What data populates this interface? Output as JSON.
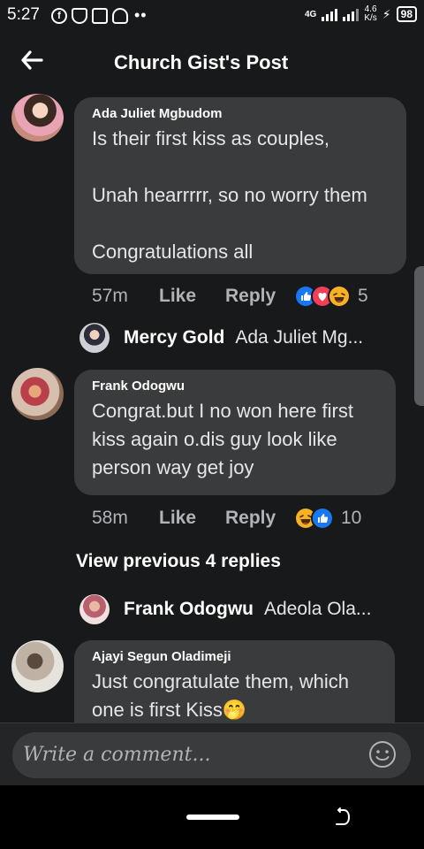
{
  "status_bar": {
    "time": "5:27",
    "network": "4G",
    "speed_value": "4.6",
    "speed_unit": "K/s",
    "battery": "98"
  },
  "header": {
    "title": "Church Gist's Post"
  },
  "comments": [
    {
      "author": "Ada Juliet Mgbudom",
      "text": "Is their first kiss as couples,\n\nUnah hearrrrr, so no worry them\n\nCongratulations all",
      "time": "57m",
      "like_label": "Like",
      "reply_label": "Reply",
      "reactions": [
        "like",
        "love",
        "haha"
      ],
      "reaction_count": "5"
    },
    {
      "author": "Frank Odogwu",
      "text": "Congrat.but I no won here first\nkiss again o.dis guy look like\nperson way get joy",
      "time": "58m",
      "like_label": "Like",
      "reply_label": "Reply",
      "reactions": [
        "haha",
        "like"
      ],
      "reaction_count": "10"
    },
    {
      "author": "Ajayi Segun Oladimeji",
      "text": "Just congratulate them, which\none is first Kiss🤭"
    }
  ],
  "reply_previews": [
    {
      "author": "Mercy Gold",
      "text": "Ada Juliet Mg..."
    },
    {
      "author": "Frank Odogwu",
      "text": "Adeola Ola..."
    }
  ],
  "view_previous_label": "View previous 4 replies",
  "composer": {
    "placeholder": "Write a comment..."
  }
}
